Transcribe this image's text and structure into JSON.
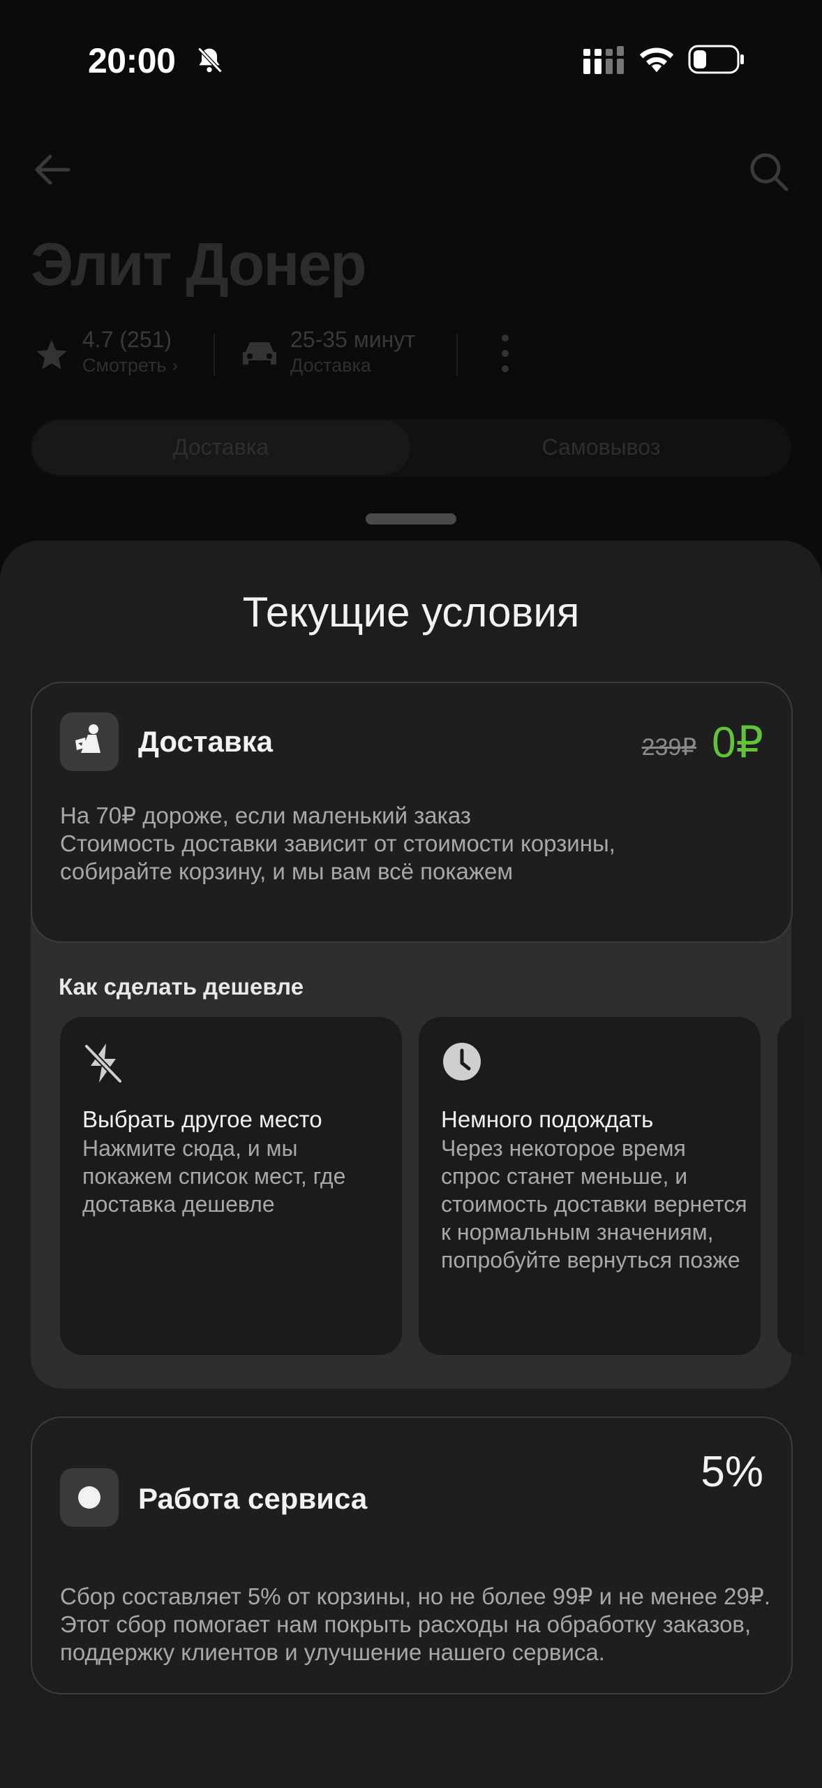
{
  "status_bar": {
    "time": "20:00"
  },
  "restaurant": {
    "name": "Элит Донер",
    "rating": "4.7 (251)",
    "rating_link": "Смотреть",
    "delivery_time": "25-35 минут",
    "delivery_label": "Доставка",
    "tabs": [
      {
        "label": "Доставка",
        "active": true
      },
      {
        "label": "Самовывоз",
        "active": false
      }
    ]
  },
  "sheet": {
    "title": "Текущие условия",
    "delivery": {
      "title": "Доставка",
      "old_price": "239₽",
      "new_price": "0₽",
      "description_lines": [
        "На 70₽ дороже, если маленький заказ",
        "Стоимость доставки зависит от стоимости корзины,",
        "собирайте корзину, и мы вам всё покажем"
      ]
    },
    "cheaper": {
      "title": "Как сделать дешевле",
      "tips": [
        {
          "icon": "lightning-off-icon",
          "title": "Выбрать другое место",
          "description": "Нажмите сюда, и мы покажем список мест, где доставка дешевле"
        },
        {
          "icon": "clock-icon",
          "title": "Немного подождать",
          "description": "Через некоторое время спрос станет меньше, и стоимость доставки вернется к нормальным значениям, попробуйте вернуться позже"
        }
      ]
    },
    "service": {
      "title": "Работа сервиса",
      "percent": "5%",
      "description": "Сбор составляет 5% от корзины, но не более 99₽ и не менее 29₽. Этот сбор помогает нам покрыть расходы на обработку заказов, поддержку клиентов и улучшение нашего сервиса."
    }
  },
  "colors": {
    "accent_green": "#63c23c",
    "sheet_bg": "#1d1d1d",
    "block_bg": "#2e2e2e"
  }
}
